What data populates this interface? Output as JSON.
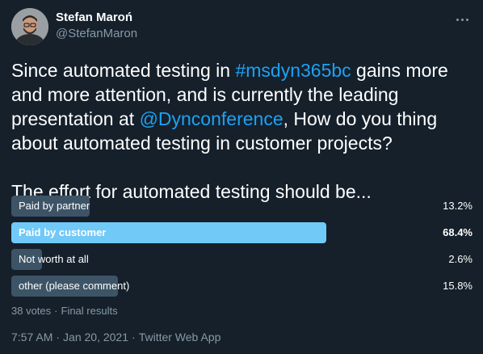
{
  "author": {
    "name": "Stefan Maroń",
    "handle": "@StefanMaron"
  },
  "more_icon": "more-dots-icon",
  "tweet": {
    "text_1": "Since automated testing in ",
    "hashtag": "#msdyn365bc",
    "text_2": " gains more and more attention, and is currently the leading presentation at ",
    "mention": "@Dynconference",
    "text_3": ", How do you thing about automated testing in customer projects?",
    "text_4": "The effort for automated testing should be..."
  },
  "poll": {
    "options": [
      {
        "label": "Paid by partner",
        "percent": "13.2%",
        "value": 13.2,
        "leading": false
      },
      {
        "label": "Paid by customer",
        "percent": "68.4%",
        "value": 68.4,
        "leading": true
      },
      {
        "label": "Not worth at all",
        "percent": "2.6%",
        "value": 2.6,
        "leading": false
      },
      {
        "label": "other (please comment)",
        "percent": "15.8%",
        "value": 15.8,
        "leading": false
      }
    ],
    "votes": "38 votes",
    "status": "Final results"
  },
  "meta": {
    "time": "7:57 AM",
    "date": "Jan 20, 2021",
    "source": "Twitter Web App"
  },
  "colors": {
    "background": "#15202b",
    "bar": "#3d5466",
    "bar_leading": "#71c9f8",
    "link": "#1da1f2",
    "muted": "#8899a6"
  }
}
